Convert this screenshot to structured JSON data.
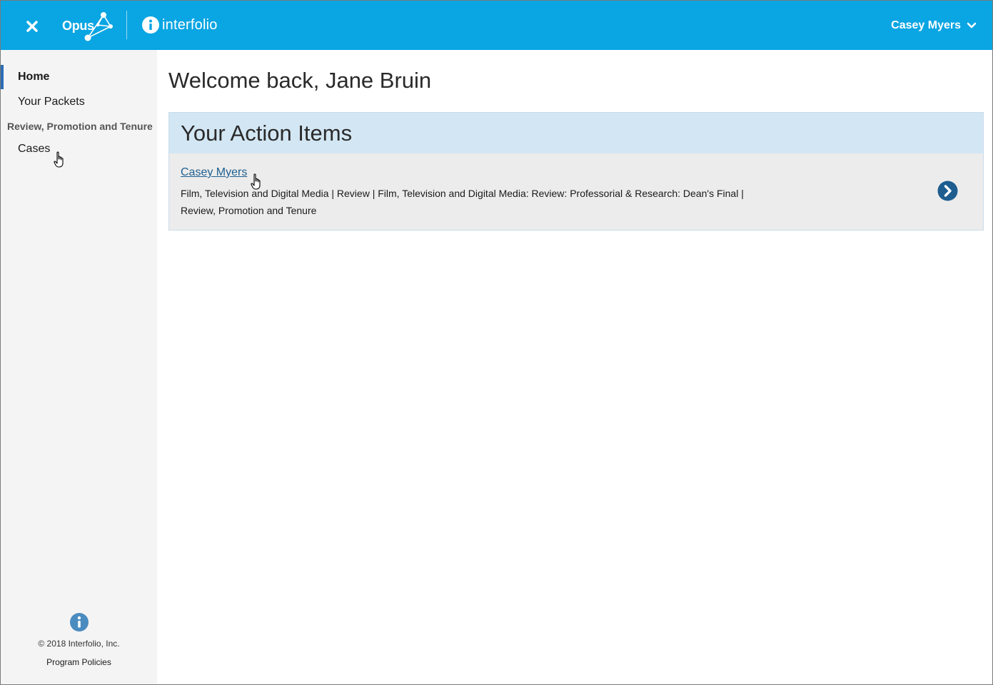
{
  "header": {
    "app_logo_text": "Opus",
    "brand_text": "interfolio",
    "user_name": "Casey Myers",
    "accent_color": "#0aa5e3"
  },
  "sidebar": {
    "items": [
      {
        "label": "Home",
        "active": true
      },
      {
        "label": "Your Packets",
        "active": false
      }
    ],
    "section_title": "Review, Promotion and Tenure",
    "section_items": [
      {
        "label": "Cases"
      }
    ],
    "footer": {
      "copyright": "© 2018 Interfolio, Inc.",
      "policies_link": "Program Policies"
    }
  },
  "main": {
    "welcome": "Welcome back, Jane Bruin",
    "action_items": {
      "title": "Your Action Items",
      "items": [
        {
          "name": "Casey Myers",
          "description": "Film, Television and Digital Media | Review | Film, Television and Digital Media: Review: Professorial & Research: Dean's Final | Review, Promotion and Tenure"
        }
      ]
    }
  },
  "icons": {
    "close": "close-icon",
    "user_dropdown": "chevron-down-icon",
    "go": "chevron-right-circle-icon",
    "info": "info-icon"
  }
}
